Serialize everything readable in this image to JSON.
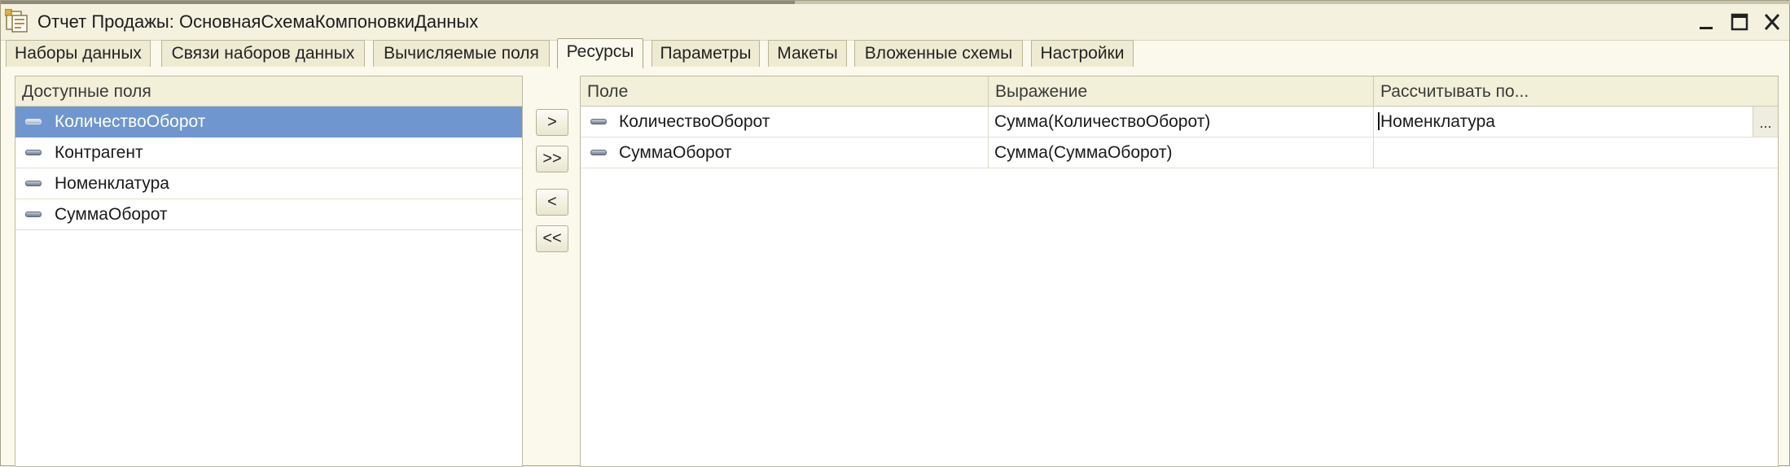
{
  "window": {
    "title": "Отчет Продажы: ОсновнаяСхемаКомпоновкиДанных",
    "icons": [
      "document-icon",
      "minimize-icon",
      "maximize-icon",
      "close-icon"
    ]
  },
  "tabs": [
    {
      "label": "Наборы данных",
      "active": false
    },
    {
      "label": "Связи наборов данных",
      "active": false
    },
    {
      "label": "Вычисляемые поля",
      "active": false
    },
    {
      "label": "Ресурсы",
      "active": true
    },
    {
      "label": "Параметры",
      "active": false
    },
    {
      "label": "Макеты",
      "active": false
    },
    {
      "label": "Вложенные схемы",
      "active": false
    },
    {
      "label": "Настройки",
      "active": false
    }
  ],
  "available_fields": {
    "header": "Доступные поля",
    "items": [
      {
        "label": "КоличествоОборот",
        "selected": true
      },
      {
        "label": "Контрагент",
        "selected": false
      },
      {
        "label": "Номенклатура",
        "selected": false
      },
      {
        "label": "СуммаОборот",
        "selected": false
      }
    ]
  },
  "move_buttons": {
    "add_one": ">",
    "add_all": ">>",
    "remove_one": "<",
    "remove_all": "<<"
  },
  "resources": {
    "columns": [
      "Поле",
      "Выражение",
      "Рассчитывать по..."
    ],
    "rows": [
      {
        "field": "КоличествоОборот",
        "expression": "Сумма(КоличествоОборот)",
        "calc_by": "Номенклатура",
        "editing": true
      },
      {
        "field": "СуммаОборот",
        "expression": "Сумма(СуммаОборот)",
        "calc_by": "",
        "editing": false
      }
    ],
    "ellipsis_label": "..."
  },
  "colors": {
    "selection": "#6f96cf",
    "background": "#fbf9ec",
    "header": "#f3f0d9"
  }
}
